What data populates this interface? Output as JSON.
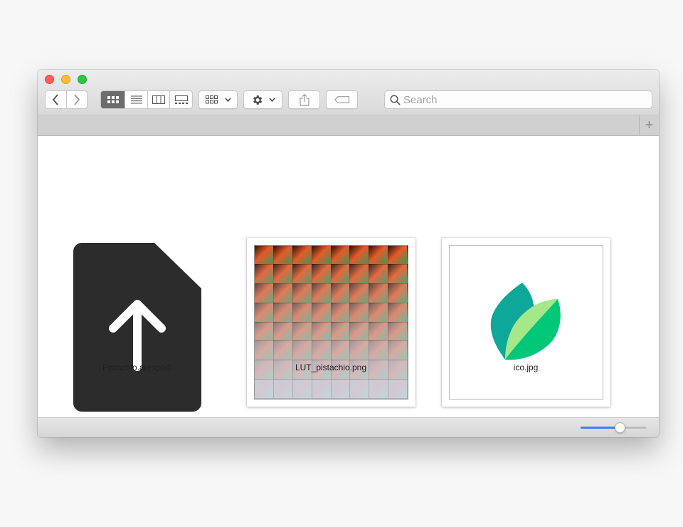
{
  "window": {
    "controls": [
      "close",
      "minimize",
      "maximize"
    ]
  },
  "toolbar": {
    "back_icon": "chevron-left-icon",
    "forward_icon": "chevron-right-icon",
    "view_modes": [
      "icon-view",
      "list-view",
      "column-view",
      "gallery-view"
    ],
    "active_view": "icon-view",
    "group_icon": "group-by-icon",
    "action_icon": "gear-icon",
    "share_icon": "share-icon",
    "tag_icon": "tag-icon"
  },
  "search": {
    "placeholder": "Search",
    "value": ""
  },
  "tabs": {
    "add_label": "+"
  },
  "files": [
    {
      "name": "Pistachio.arexport",
      "kind": "document-upload-icon"
    },
    {
      "name": "LUT_pistachio.png",
      "kind": "lut-image-thumbnail"
    },
    {
      "name": "ico.jpg",
      "kind": "leaf-logo-thumbnail"
    }
  ],
  "icon_size_slider": {
    "value": 0.6
  },
  "colors": {
    "close": "#fe5f57",
    "minimize": "#febc2e",
    "maximize": "#28c840",
    "accent": "#3b82f6",
    "leaf_dark": "#0ea89a",
    "leaf_light": "#00c878",
    "leaf_pale": "#a4e88a"
  }
}
